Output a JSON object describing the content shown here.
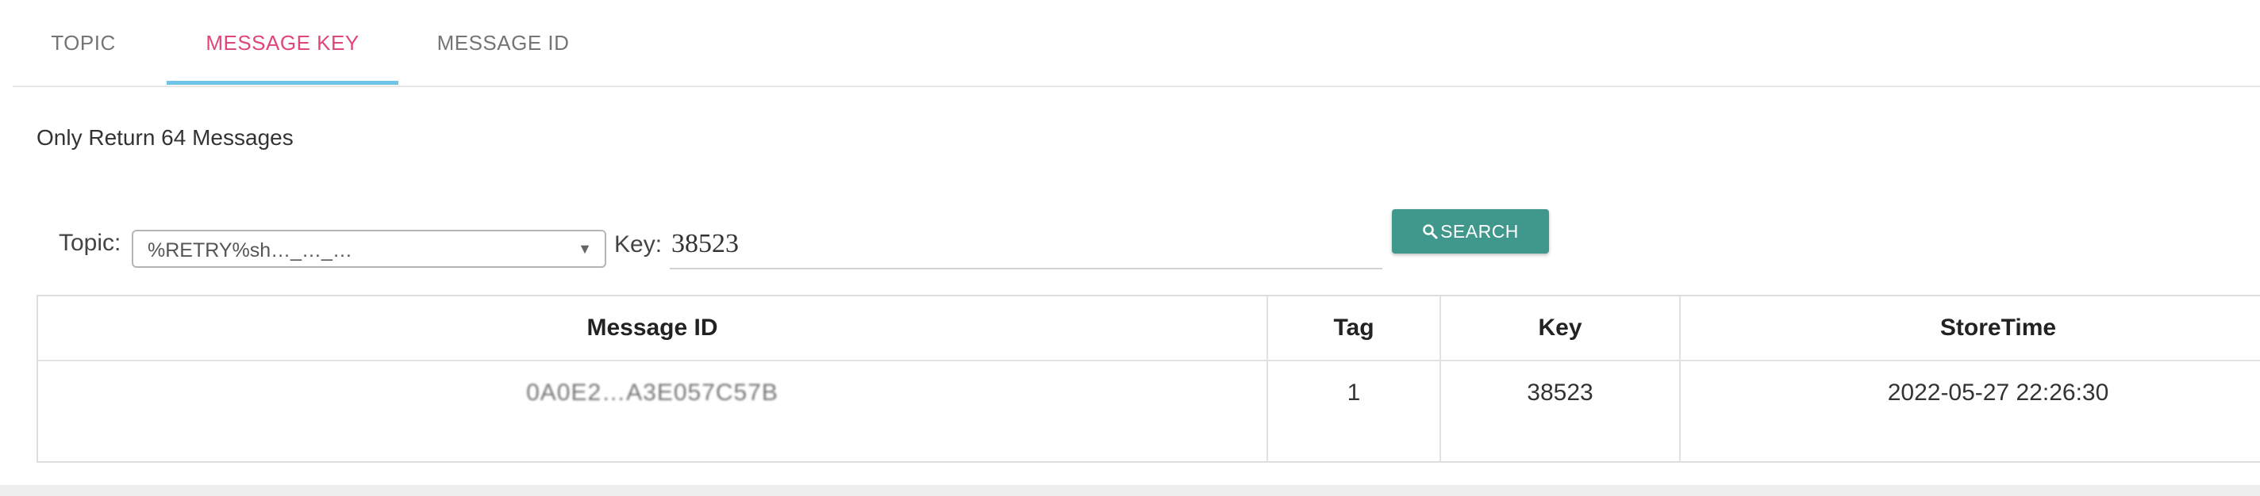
{
  "tabs": [
    {
      "label": "TOPIC"
    },
    {
      "label": "MESSAGE KEY"
    },
    {
      "label": "MESSAGE ID"
    }
  ],
  "active_tab": "MESSAGE KEY",
  "info_text": "Only Return 64 Messages",
  "form": {
    "topic_label": "Topic:",
    "topic_value": "%RETRY%sh…_…_…",
    "key_label": "Key:",
    "key_value": "38523",
    "search_label": "SEARCH",
    "search_icon": "search-icon"
  },
  "table": {
    "columns": [
      "Message ID",
      "Tag",
      "Key",
      "StoreTime"
    ],
    "rows": [
      {
        "message_id": "0A0E2…A3E057C57B",
        "tag": "1",
        "key": "38523",
        "store_time": "2022-05-27 22:26:30"
      }
    ]
  },
  "colors": {
    "active_tab": "#e0457b",
    "tab_ink": "#6fc3e8",
    "search_button": "#40978b"
  }
}
